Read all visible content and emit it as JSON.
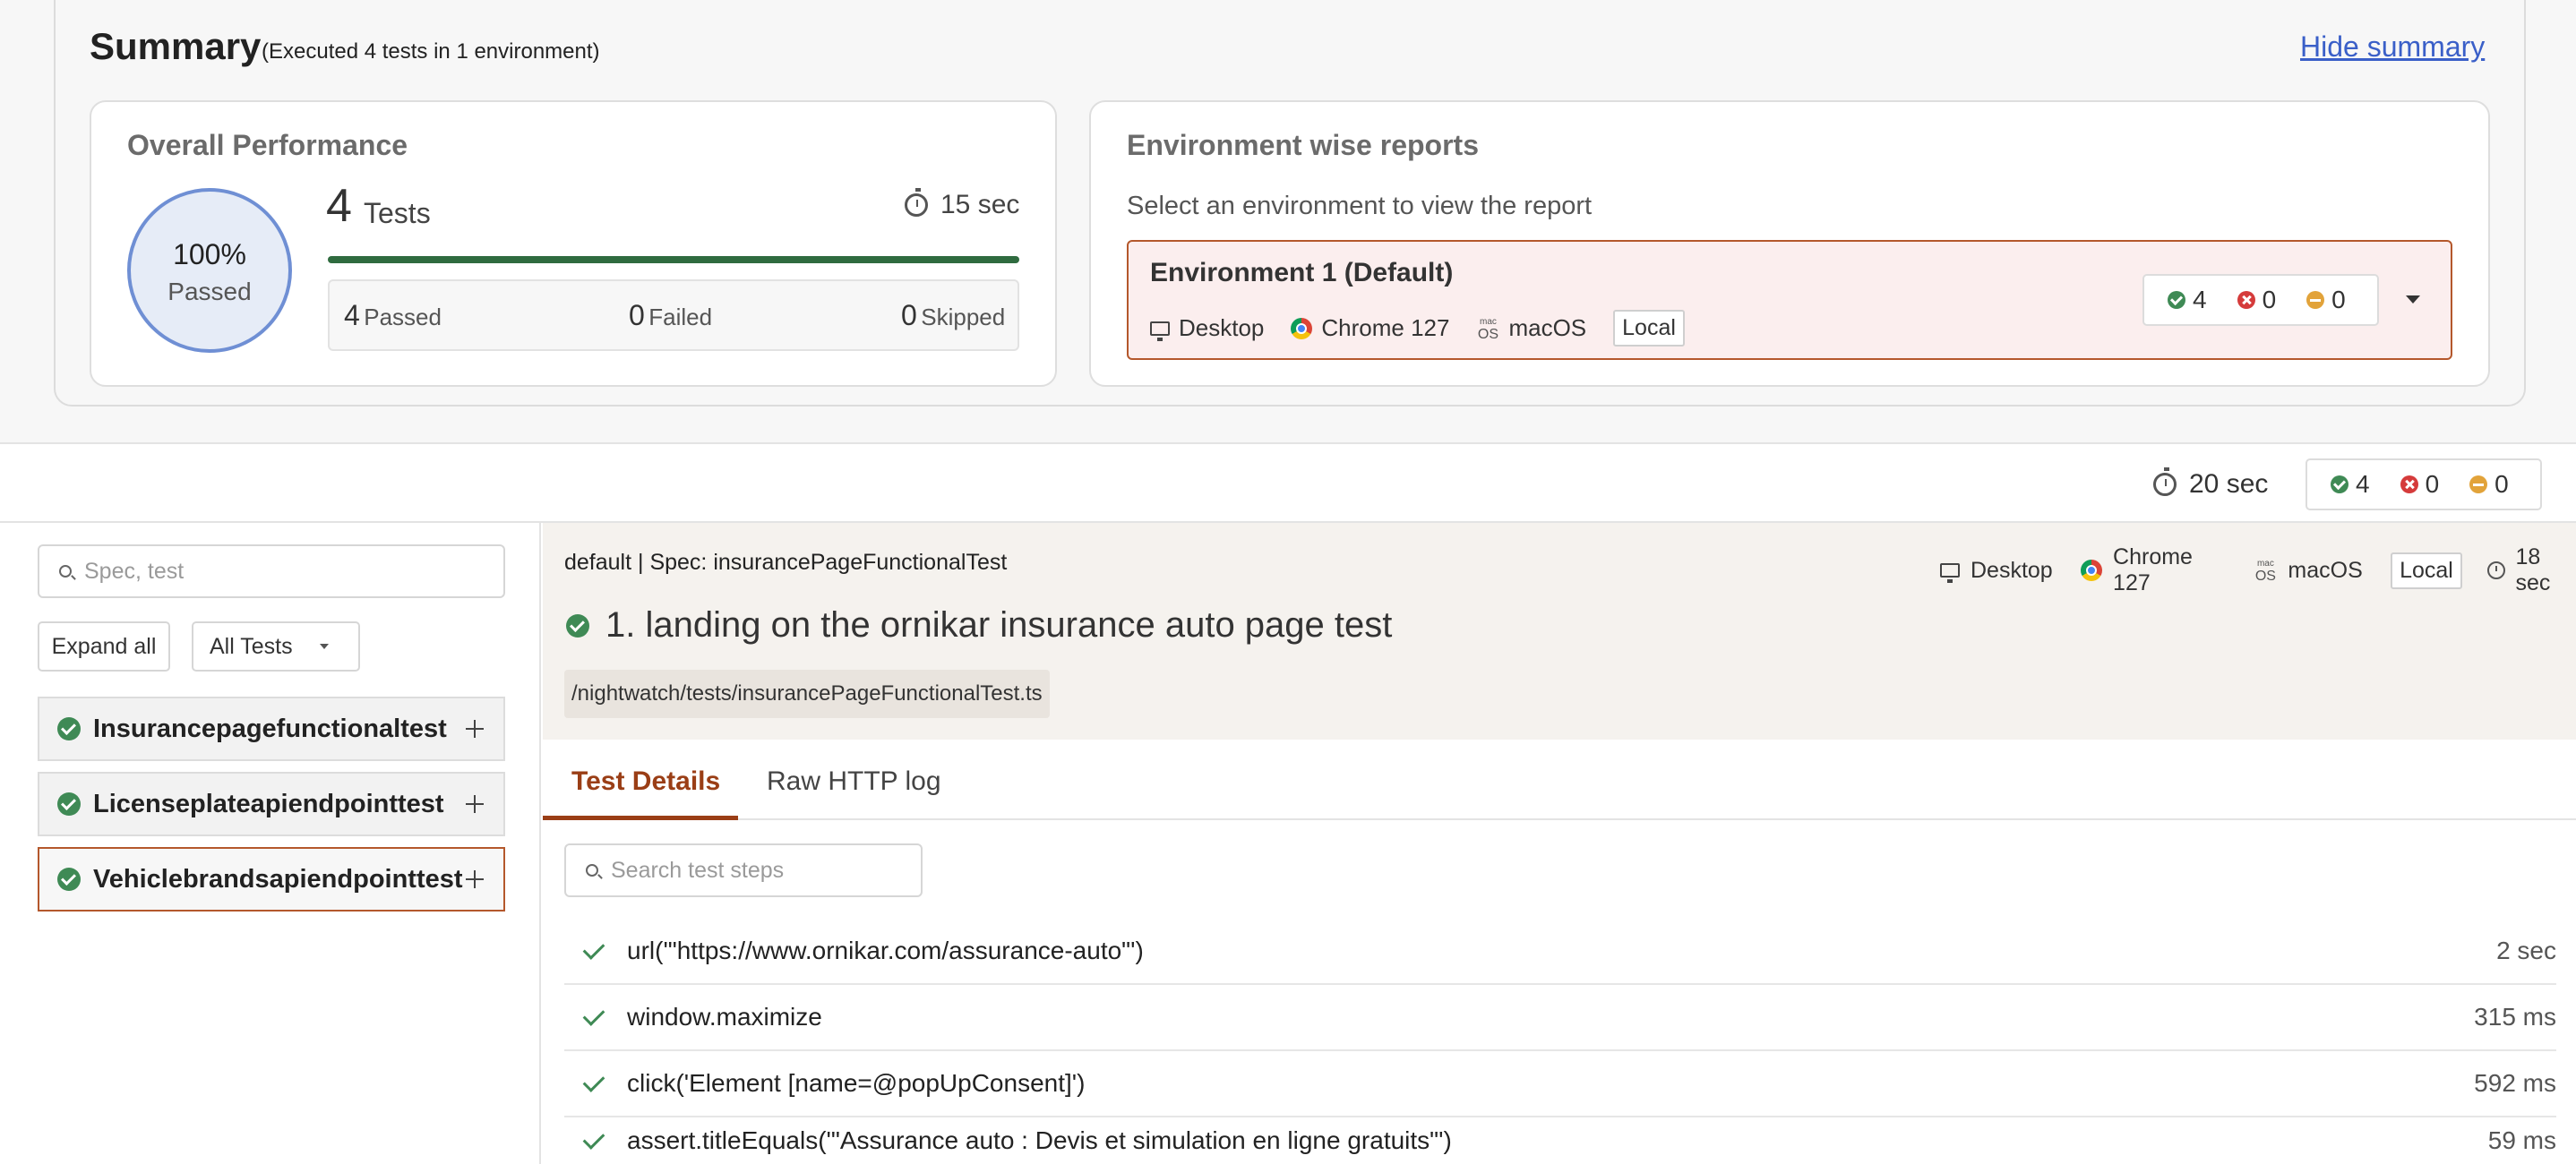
{
  "summary": {
    "title": "Summary",
    "subtitle": "(Executed 4 tests in 1 environment)",
    "hide_link": "Hide summary"
  },
  "overall": {
    "title": "Overall Performance",
    "pass_percent": "100%",
    "pass_label": "Passed",
    "tests_count": "4",
    "tests_label": "Tests",
    "duration": "15 sec",
    "progress_fraction": 1.0,
    "passed_num": "4",
    "passed_label": "Passed",
    "failed_num": "0",
    "failed_label": "Failed",
    "skipped_num": "0",
    "skipped_label": "Skipped"
  },
  "environment": {
    "title": "Environment wise reports",
    "prompt": "Select an environment to view the report",
    "selected": {
      "name": "Environment 1 (Default)",
      "device": "Desktop",
      "browser": "Chrome 127",
      "os": "macOS",
      "location": "Local",
      "passed": "4",
      "failed": "0",
      "skipped": "0"
    }
  },
  "topbar": {
    "duration": "20 sec",
    "passed": "4",
    "failed": "0",
    "skipped": "0"
  },
  "sidebar": {
    "search_placeholder": "Spec, test",
    "expand_all": "Expand all",
    "filter_value": "All Tests",
    "specs": [
      {
        "name": "Insurancepagefunctionaltest"
      },
      {
        "name": "Licenseplateapiendpointtest"
      },
      {
        "name": "Vehiclebrandsapiendpointtest"
      }
    ]
  },
  "detail": {
    "breadcrumb": "default | Spec: insurancePageFunctionalTest",
    "device": "Desktop",
    "browser": "Chrome 127",
    "os": "macOS",
    "location": "Local",
    "duration": "18 sec",
    "test_title": "1. landing on the ornikar insurance auto page test",
    "file_path": "/nightwatch/tests/insurancePageFunctionalTest.ts",
    "tabs": [
      "Test Details",
      "Raw HTTP log"
    ],
    "steps_search_placeholder": "Search test steps",
    "steps": [
      {
        "cmd": "url('\"https://www.ornikar.com/assurance-auto\"')",
        "time": "2 sec"
      },
      {
        "cmd": "window.maximize",
        "time": "315 ms"
      },
      {
        "cmd": "click('Element [name=@popUpConsent]')",
        "time": "592 ms"
      },
      {
        "cmd": "assert.titleEquals('\"Assurance auto : Devis et simulation en ligne gratuits\"')",
        "time": "59 ms"
      }
    ]
  },
  "colors": {
    "pass": "#3f8a55",
    "fail": "#d53b3b",
    "skip": "#e2a33a",
    "accent": "#9a3e16",
    "link": "#3a5fc8"
  }
}
